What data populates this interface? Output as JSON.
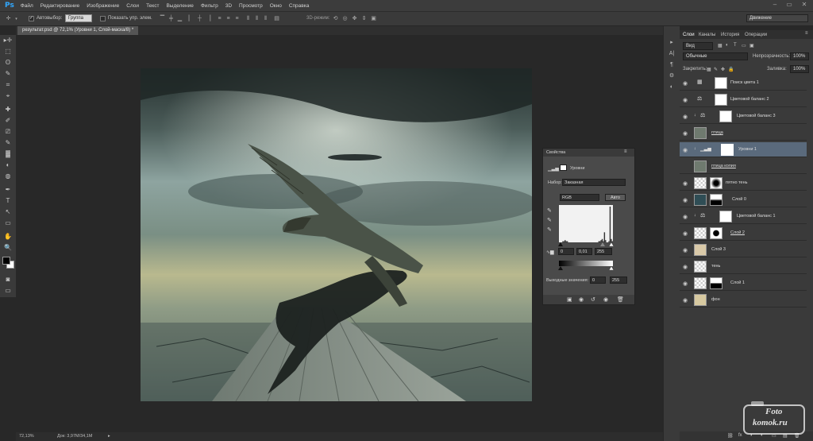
{
  "menubar": {
    "logo": "Ps",
    "items": [
      "Файл",
      "Редактирование",
      "Изображение",
      "Слои",
      "Текст",
      "Выделение",
      "Фильтр",
      "3D",
      "Просмотр",
      "Окно",
      "Справка"
    ],
    "controls": [
      "–",
      "▭",
      "✕"
    ]
  },
  "options": {
    "autoselect_label": "Автовыбор:",
    "autoselect_value": "Группа",
    "show_controls_label": "Показать упр. элем.",
    "mode_3d_label": "3D-режим:",
    "workspace": "Движение"
  },
  "document": {
    "tab_title": "результат.psd @ 72,1% (Уровни 1, Слой-маска/8) *",
    "zoom": "72,13%",
    "doc_info": "Док: 3,97М/34,1М"
  },
  "tools": [
    "▸✛",
    "⬚",
    "ʘ",
    "✎",
    "⌗",
    "⌖",
    "✚",
    "✐",
    "⎚",
    "✎",
    "▓",
    "◐",
    "◍",
    "✒",
    "T",
    "↖",
    "▭",
    "✋",
    "🔍"
  ],
  "side_icons": [
    "▸",
    "A|",
    "¶",
    "⚙",
    "◐"
  ],
  "layers_panel": {
    "tabs": [
      "Слои",
      "Каналы",
      "История",
      "Операции"
    ],
    "filter_kind": "Вид",
    "blend_mode": "Обычные",
    "opacity_label": "Непрозрачность:",
    "opacity_value": "100%",
    "lock_label": "Закрепить:",
    "fill_label": "Заливка:",
    "fill_value": "100%",
    "layers": [
      {
        "name": "Поиск цвета 1",
        "icon": "▦"
      },
      {
        "name": "Цветовой баланс 2",
        "icon": "⚖"
      },
      {
        "name": "Цветовой баланс 3",
        "icon": "⚖"
      },
      {
        "name": "птица",
        "icon": ""
      },
      {
        "name": "Уровни 1",
        "icon": "▁▃▅"
      },
      {
        "name": "птица копия",
        "icon": ""
      },
      {
        "name": "пятно тень",
        "icon": ""
      },
      {
        "name": "Слой 0",
        "icon": ""
      },
      {
        "name": "Цветовой баланс 1",
        "icon": "⚖"
      },
      {
        "name": "Слой 2",
        "icon": ""
      },
      {
        "name": "Слой 3",
        "icon": ""
      },
      {
        "name": "тень",
        "icon": ""
      },
      {
        "name": "Слой 1",
        "icon": ""
      },
      {
        "name": "фон",
        "icon": ""
      }
    ],
    "footer_icons": [
      "⛓",
      "fx",
      "◑",
      "◐",
      "▭",
      "▤",
      "🗑"
    ]
  },
  "properties": {
    "title": "Свойства",
    "header": "Уровни",
    "preset_label": "Набор:",
    "preset_value": "Заказная",
    "channel": "RGB",
    "auto_label": "Авто",
    "input_black": "0",
    "input_gamma": "0,01",
    "input_white": "255",
    "output_label": "Выходные значения:",
    "output_black": "0",
    "output_white": "255"
  },
  "watermark": {
    "line1": "Foto",
    "line2": "komok.ru"
  },
  "histogram": [
    0,
    0,
    0,
    1,
    1,
    2,
    1,
    1,
    0,
    0,
    0,
    0,
    0,
    0,
    0,
    0,
    0,
    0,
    0,
    0,
    0,
    0,
    0,
    0,
    0,
    0,
    0,
    0,
    0,
    0,
    0,
    0,
    0,
    0,
    0,
    1,
    1,
    2,
    3,
    1,
    9,
    2,
    0,
    0,
    1,
    32,
    3,
    1
  ]
}
